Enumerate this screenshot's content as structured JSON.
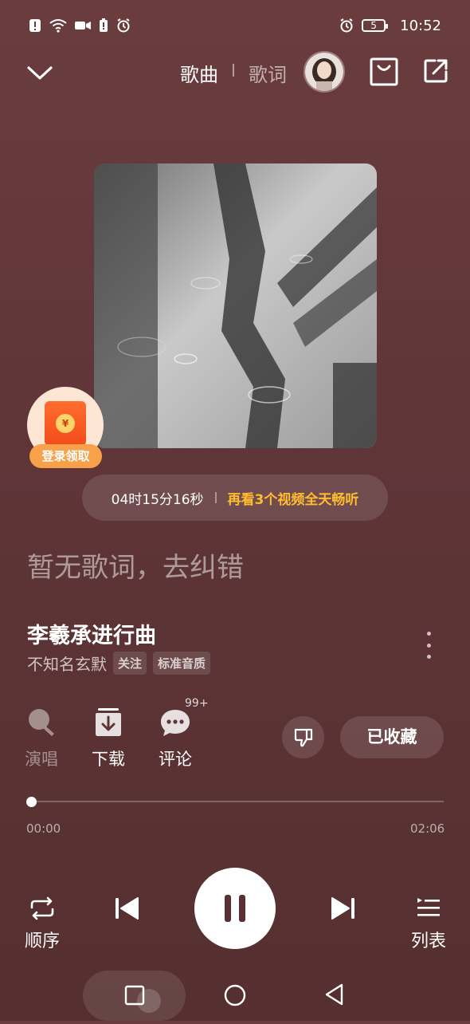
{
  "status_bar": {
    "time": "10:52",
    "battery_level": "5",
    "icons": [
      "alert-icon",
      "wifi-icon",
      "camera-icon",
      "battery-alert-icon",
      "alarm-icon"
    ]
  },
  "header": {
    "tab_song": "歌曲",
    "tab_lyrics": "歌词"
  },
  "promo": {
    "red_packet_label": "登录领取",
    "countdown": "04时15分16秒",
    "offer": "再看3个视频全天畅听"
  },
  "lyrics": {
    "empty_text": "暂无歌词，去纠错"
  },
  "song": {
    "title": "李羲承进行曲",
    "artist": "不知名玄默",
    "follow_tag": "关注",
    "quality_tag": "标准音质"
  },
  "actions": {
    "sing": "演唱",
    "download": "下载",
    "comment": "评论",
    "comment_count": "99+",
    "collected": "已收藏"
  },
  "progress": {
    "current": "00:00",
    "total": "02:06",
    "fraction": 0.0
  },
  "controls": {
    "play_mode": "顺序",
    "playlist": "列表",
    "state": "playing"
  },
  "colors": {
    "background": "#5f3538",
    "promo_text": "#ffbd2e",
    "red_packet": "#f24b1a"
  }
}
